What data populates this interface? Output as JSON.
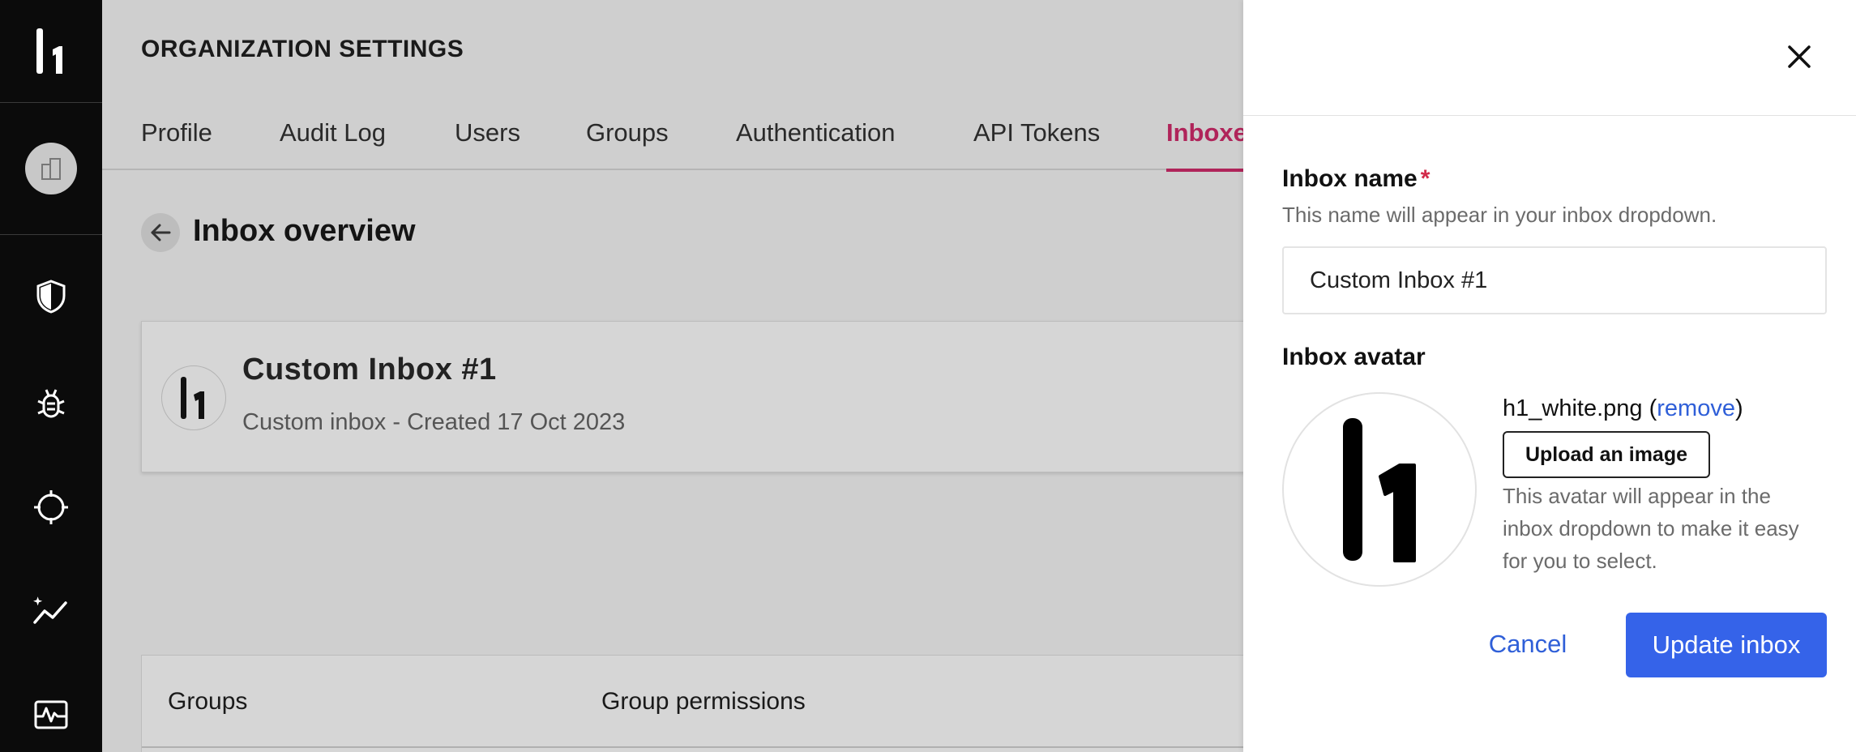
{
  "header": {
    "title": "ORGANIZATION SETTINGS"
  },
  "tabs": [
    {
      "label": "Profile"
    },
    {
      "label": "Audit Log"
    },
    {
      "label": "Users"
    },
    {
      "label": "Groups"
    },
    {
      "label": "Authentication"
    },
    {
      "label": "API Tokens"
    },
    {
      "label": "Inboxes",
      "active": true
    }
  ],
  "overview": {
    "title": "Inbox overview"
  },
  "inbox_card": {
    "name": "Custom Inbox #1",
    "subtitle": "Custom inbox - Created 17 Oct 2023"
  },
  "groups_table": {
    "columns": [
      "Groups",
      "Group permissions"
    ]
  },
  "sidebar": {
    "icons": [
      "logo-icon",
      "organization-icon",
      "shield-icon",
      "bug-icon",
      "target-icon",
      "analytics-icon",
      "settings-sliders-icon"
    ]
  },
  "drawer": {
    "inbox_name_label": "Inbox name",
    "required_marker": "*",
    "inbox_name_help": "This name will appear in your inbox dropdown.",
    "inbox_name_value": "Custom Inbox #1",
    "inbox_avatar_label": "Inbox avatar",
    "file_name": "h1_white.png",
    "file_paren_open": " (",
    "remove_label": "remove",
    "file_paren_close": ")",
    "upload_label": "Upload an image",
    "avatar_help": "This avatar will appear in the inbox dropdown to make it easy for you to select.",
    "cancel_label": "Cancel",
    "submit_label": "Update inbox"
  },
  "colors": {
    "accent_active_tab": "#b0245a",
    "primary_button": "#3563e9",
    "link": "#2f5fd8",
    "required": "#d22b4a",
    "rail": "#0b0b0b"
  }
}
